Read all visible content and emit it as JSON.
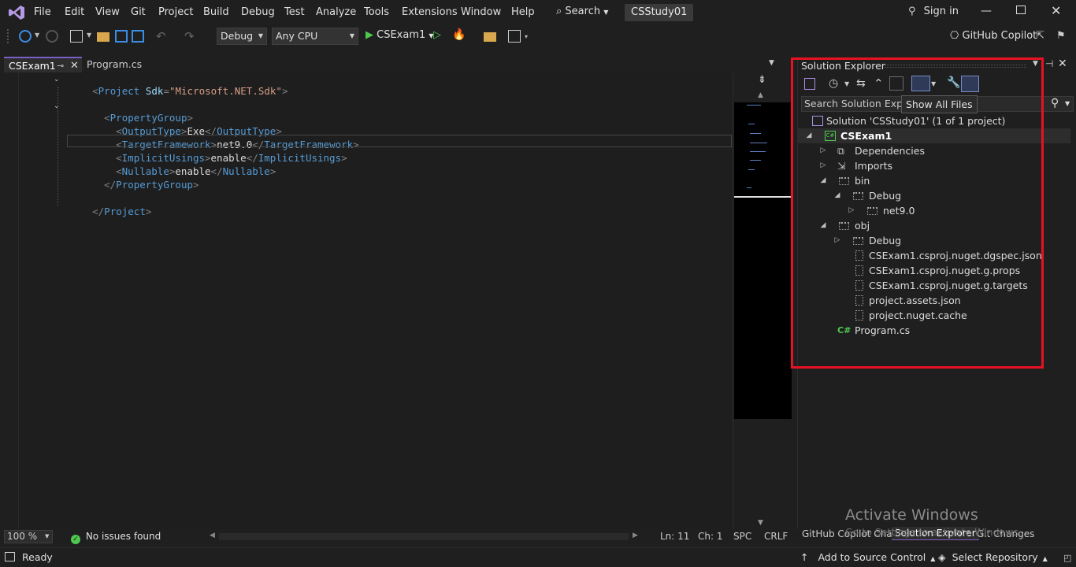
{
  "titlebar": {
    "menu": [
      "File",
      "Edit",
      "View",
      "Git",
      "Project",
      "Build",
      "Debug",
      "Test",
      "Analyze",
      "Tools",
      "Extensions",
      "Window",
      "Help"
    ],
    "search_label": "Search",
    "solution_name": "CSStudy01",
    "sign_in": "Sign in"
  },
  "toolbar": {
    "config": "Debug",
    "platform": "Any CPU",
    "start_target": "CSExam1",
    "copilot": "GitHub Copilot"
  },
  "tabs": [
    {
      "label": "CSExam1",
      "active": true
    },
    {
      "label": "Program.cs",
      "active": false
    }
  ],
  "editor": {
    "lines": [
      {
        "indent": 0,
        "open": "Project",
        "attr": "Sdk",
        "value": "\"Microsoft.NET.Sdk\"",
        "fold": true
      },
      {
        "indent": 1,
        "open": "PropertyGroup",
        "fold": true
      },
      {
        "indent": 2,
        "open": "OutputType",
        "text": "Exe",
        "close": "OutputType"
      },
      {
        "indent": 2,
        "open": "TargetFramework",
        "text": "net9.0",
        "close": "TargetFramework"
      },
      {
        "indent": 2,
        "open": "ImplicitUsings",
        "text": "enable",
        "close": "ImplicitUsings"
      },
      {
        "indent": 2,
        "open": "Nullable",
        "text": "enable",
        "close": "Nullable"
      },
      {
        "indent": 1,
        "closeOnly": "PropertyGroup"
      },
      {
        "indent": 0,
        "closeOnly": "Project"
      }
    ]
  },
  "editor_status": {
    "zoom": "100 %",
    "issues": "No issues found",
    "line": "Ln: 11",
    "col": "Ch: 1",
    "spacing": "SPC",
    "eol": "CRLF"
  },
  "solution_explorer": {
    "title": "Solution Explorer",
    "search_placeholder": "Search Solution Explorer",
    "tooltip": "Show All Files",
    "solution_row": "Solution 'CSStudy01' (1 of 1 project)",
    "project": "CSExam1",
    "items": {
      "dependencies": "Dependencies",
      "imports": "Imports",
      "bin": "bin",
      "bin_debug": "Debug",
      "net9": "net9.0",
      "obj": "obj",
      "obj_debug": "Debug",
      "f1": "CSExam1.csproj.nuget.dgspec.json",
      "f2": "CSExam1.csproj.nuget.g.props",
      "f3": "CSExam1.csproj.nuget.g.targets",
      "f4": "project.assets.json",
      "f5": "project.nuget.cache",
      "program": "Program.cs"
    },
    "bottom_tabs": [
      "GitHub Copilot Chat",
      "Solution Explorer",
      "Git Changes"
    ]
  },
  "statusbar": {
    "ready": "Ready",
    "source_control": "Add to Source Control",
    "repository": "Select Repository"
  },
  "watermark": {
    "title": "Activate Windows",
    "subtitle": "Go to Settings to activate Windows."
  },
  "colors": {
    "highlight": "#e81123",
    "accent_vs": "#7b5fc7",
    "green": "#4ec94e"
  }
}
